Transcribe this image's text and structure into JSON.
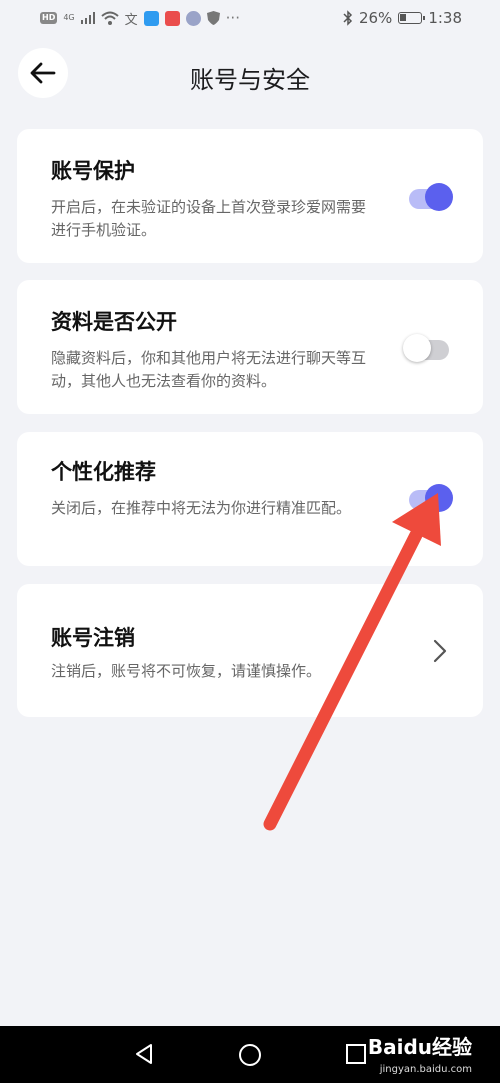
{
  "status_bar": {
    "hd": "HD",
    "network": "4G",
    "battery": "26%",
    "time": "1:38"
  },
  "header": {
    "title": "账号与安全"
  },
  "cards": [
    {
      "title": "账号保护",
      "desc": "开启后，在未验证的设备上首次登录珍爱网需要进行手机验证。",
      "toggle": "on"
    },
    {
      "title": "资料是否公开",
      "desc": "隐藏资料后，你和其他用户将无法进行聊天等互动，其他人也无法查看你的资料。",
      "toggle": "off"
    },
    {
      "title": "个性化推荐",
      "desc": "关闭后，在推荐中将无法为你进行精准匹配。",
      "toggle": "on"
    },
    {
      "title": "账号注销",
      "desc": "注销后，账号将不可恢复，请谨慎操作。"
    }
  ],
  "watermark": {
    "logo": "Baidu经验",
    "url": "jingyan.baidu.com"
  },
  "colors": {
    "accent": "#5b60ee",
    "toggle_track_on": "#b9bcf7",
    "annotation_arrow": "#ee4a3c"
  },
  "icons": {
    "back": "back-arrow-icon",
    "chevron": "chevron-right-icon",
    "nav_back": "triangle-back-icon",
    "nav_home": "circle-home-icon",
    "nav_recent": "square-recent-icon"
  }
}
